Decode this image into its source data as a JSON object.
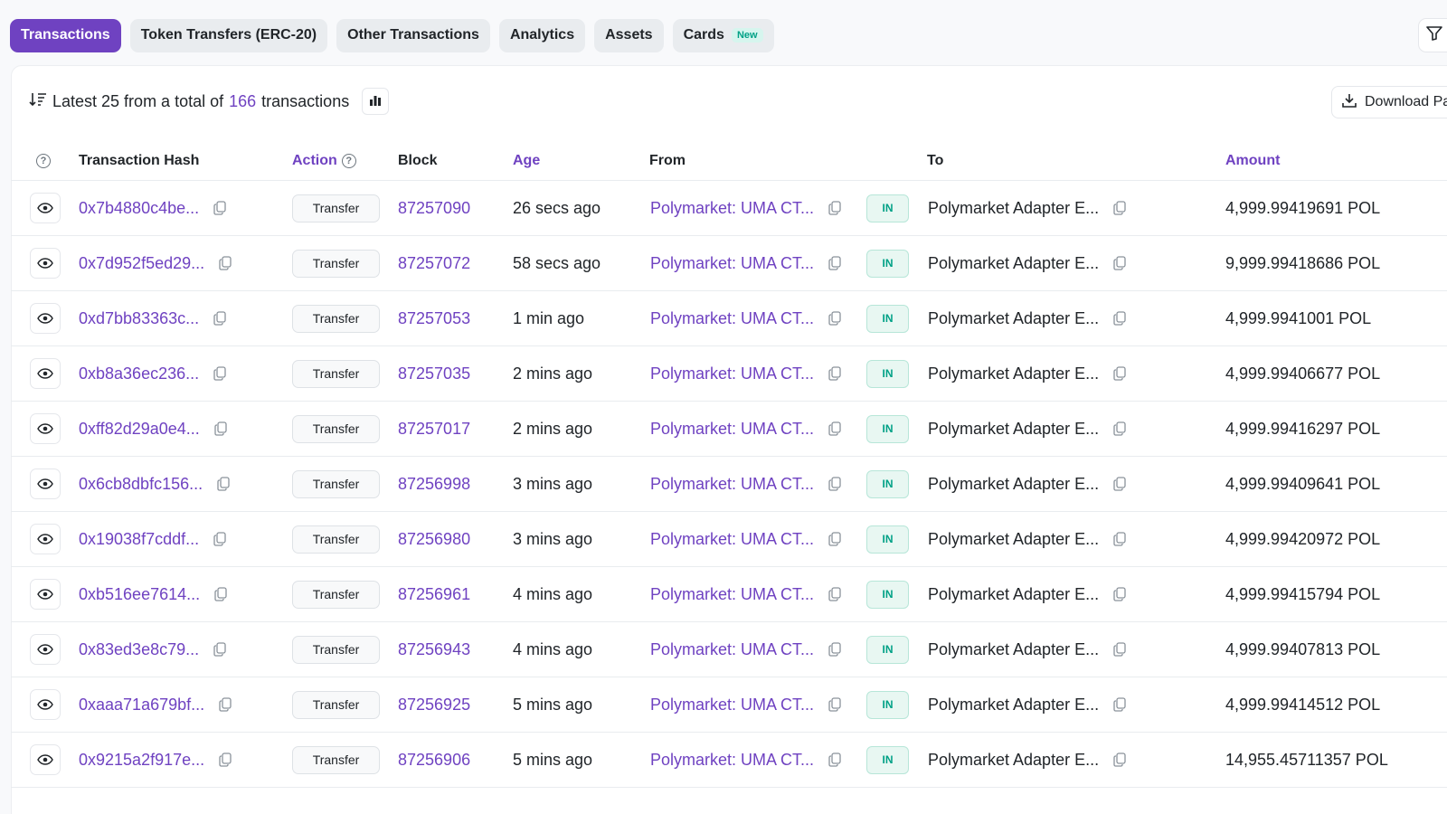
{
  "tabs": [
    {
      "label": "Transactions",
      "active": true
    },
    {
      "label": "Token Transfers (ERC-20)"
    },
    {
      "label": "Other Transactions"
    },
    {
      "label": "Analytics"
    },
    {
      "label": "Assets"
    },
    {
      "label": "Cards",
      "badge": "New"
    }
  ],
  "summary": {
    "prefix": "Latest 25 from a total of",
    "count": "166",
    "suffix": "transactions"
  },
  "download_label": "Download Pa",
  "columns": {
    "hash": "Transaction Hash",
    "action": "Action",
    "block": "Block",
    "age": "Age",
    "from": "From",
    "to": "To",
    "amount": "Amount"
  },
  "colors": {
    "accent": "#6f42c1",
    "in_badge": "#00a186"
  },
  "rows": [
    {
      "hash": "0x7b4880c4be...",
      "action": "Transfer",
      "block": "87257090",
      "age": "26 secs ago",
      "from": "Polymarket: UMA CT...",
      "direction": "IN",
      "to": "Polymarket Adapter E...",
      "amount": "4,999.99419691 POL"
    },
    {
      "hash": "0x7d952f5ed29...",
      "action": "Transfer",
      "block": "87257072",
      "age": "58 secs ago",
      "from": "Polymarket: UMA CT...",
      "direction": "IN",
      "to": "Polymarket Adapter E...",
      "amount": "9,999.99418686 POL"
    },
    {
      "hash": "0xd7bb83363c...",
      "action": "Transfer",
      "block": "87257053",
      "age": "1 min ago",
      "from": "Polymarket: UMA CT...",
      "direction": "IN",
      "to": "Polymarket Adapter E...",
      "amount": "4,999.9941001 POL"
    },
    {
      "hash": "0xb8a36ec236...",
      "action": "Transfer",
      "block": "87257035",
      "age": "2 mins ago",
      "from": "Polymarket: UMA CT...",
      "direction": "IN",
      "to": "Polymarket Adapter E...",
      "amount": "4,999.99406677 POL"
    },
    {
      "hash": "0xff82d29a0e4...",
      "action": "Transfer",
      "block": "87257017",
      "age": "2 mins ago",
      "from": "Polymarket: UMA CT...",
      "direction": "IN",
      "to": "Polymarket Adapter E...",
      "amount": "4,999.99416297 POL"
    },
    {
      "hash": "0x6cb8dbfc156...",
      "action": "Transfer",
      "block": "87256998",
      "age": "3 mins ago",
      "from": "Polymarket: UMA CT...",
      "direction": "IN",
      "to": "Polymarket Adapter E...",
      "amount": "4,999.99409641 POL"
    },
    {
      "hash": "0x19038f7cddf...",
      "action": "Transfer",
      "block": "87256980",
      "age": "3 mins ago",
      "from": "Polymarket: UMA CT...",
      "direction": "IN",
      "to": "Polymarket Adapter E...",
      "amount": "4,999.99420972 POL"
    },
    {
      "hash": "0xb516ee7614...",
      "action": "Transfer",
      "block": "87256961",
      "age": "4 mins ago",
      "from": "Polymarket: UMA CT...",
      "direction": "IN",
      "to": "Polymarket Adapter E...",
      "amount": "4,999.99415794 POL"
    },
    {
      "hash": "0x83ed3e8c79...",
      "action": "Transfer",
      "block": "87256943",
      "age": "4 mins ago",
      "from": "Polymarket: UMA CT...",
      "direction": "IN",
      "to": "Polymarket Adapter E...",
      "amount": "4,999.99407813 POL"
    },
    {
      "hash": "0xaaa71a679bf...",
      "action": "Transfer",
      "block": "87256925",
      "age": "5 mins ago",
      "from": "Polymarket: UMA CT...",
      "direction": "IN",
      "to": "Polymarket Adapter E...",
      "amount": "4,999.99414512 POL"
    },
    {
      "hash": "0x9215a2f917e...",
      "action": "Transfer",
      "block": "87256906",
      "age": "5 mins ago",
      "from": "Polymarket: UMA CT...",
      "direction": "IN",
      "to": "Polymarket Adapter E...",
      "amount": "14,955.45711357 POL"
    }
  ]
}
